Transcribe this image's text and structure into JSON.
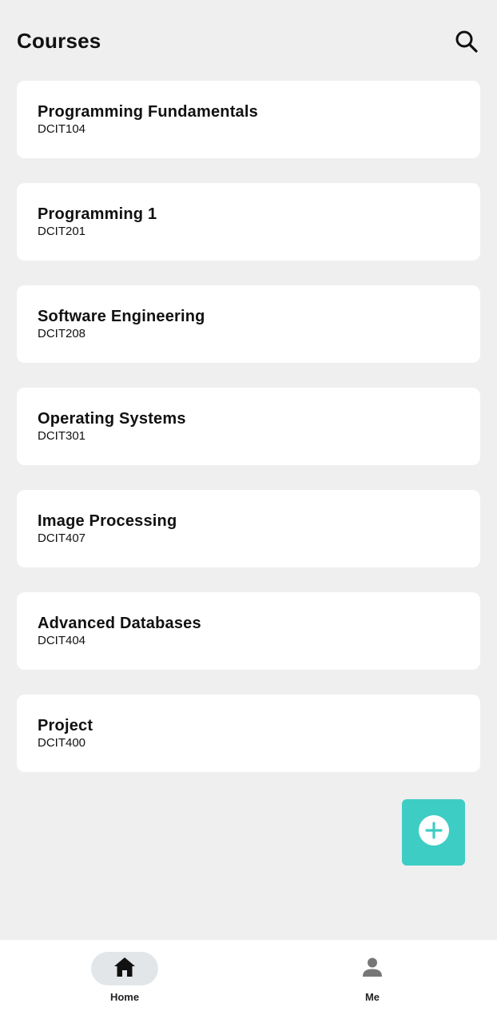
{
  "header": {
    "title": "Courses",
    "search_icon": "search-icon"
  },
  "courses": [
    {
      "name": "Programming Fundamentals",
      "code": "DCIT104"
    },
    {
      "name": "Programming 1",
      "code": "DCIT201"
    },
    {
      "name": "Software Engineering",
      "code": "DCIT208"
    },
    {
      "name": "Operating Systems",
      "code": "DCIT301"
    },
    {
      "name": "Image Processing",
      "code": "DCIT407"
    },
    {
      "name": "Advanced Databases",
      "code": "DCIT404"
    },
    {
      "name": "Project",
      "code": "DCIT400"
    }
  ],
  "fab": {
    "icon": "plus-circle-icon",
    "color": "#3ecdc4"
  },
  "bottom_nav": {
    "items": [
      {
        "label": "Home",
        "icon": "home-icon",
        "active": true
      },
      {
        "label": "Me",
        "icon": "person-icon",
        "active": false
      }
    ]
  }
}
